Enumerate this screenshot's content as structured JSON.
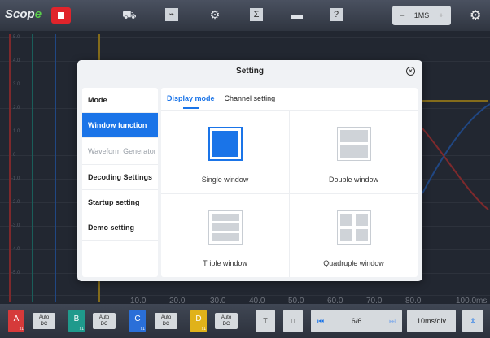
{
  "app": {
    "logo_prefix": "Scop",
    "logo_suffix": "e"
  },
  "toolbar": {
    "icons": [
      "stop-icon",
      "car-icon",
      "waveform-icon",
      "gear-icon",
      "sigma-icon",
      "folder-icon",
      "help-icon"
    ],
    "timebase_value": "1MS",
    "minus": "−",
    "plus": "+"
  },
  "axis": {
    "y_labels": [
      "5.0",
      "4.0",
      "3.0",
      "2.0",
      "1.0",
      "0",
      "-1.0",
      "-2.0",
      "-3.0",
      "-4.0",
      "-5.0"
    ],
    "x_labels": [
      "10.0",
      "20.0",
      "30.0",
      "40.0",
      "50.0",
      "60.0",
      "70.0",
      "80.0",
      "100.0ms"
    ]
  },
  "dialog": {
    "title": "Setting",
    "close": "×",
    "menu": [
      {
        "label": "Mode"
      },
      {
        "label": "Window function"
      },
      {
        "label": "Waveform Generator"
      },
      {
        "label": "Decoding Settings"
      },
      {
        "label": "Startup setting"
      },
      {
        "label": "Demo setting"
      }
    ],
    "tabs": [
      {
        "label": "Display mode"
      },
      {
        "label": "Channel setting"
      }
    ],
    "modes": [
      {
        "label": "Single window"
      },
      {
        "label": "Double window"
      },
      {
        "label": "Triple window"
      },
      {
        "label": "Quadruple window"
      }
    ]
  },
  "bottombar": {
    "channels": [
      {
        "letter": "A",
        "sub": "x1",
        "coupling": "Auto\nDC",
        "color": "#d63a3a"
      },
      {
        "letter": "B",
        "sub": "x1",
        "coupling": "Auto\nDC",
        "color": "#1f9a8c"
      },
      {
        "letter": "C",
        "sub": "x1",
        "coupling": "Auto\nDC",
        "color": "#2a6fd8"
      },
      {
        "letter": "D",
        "sub": "x1",
        "coupling": "Auto\nDC",
        "color": "#e0b21a"
      }
    ],
    "page": "6/6",
    "timebase": "10ms/div"
  },
  "colors": {
    "accent": "#1a74e8",
    "ch_a": "#d63a3a",
    "ch_b": "#1f9a8c",
    "ch_c": "#2a6fd8",
    "ch_d": "#e0b21a"
  }
}
